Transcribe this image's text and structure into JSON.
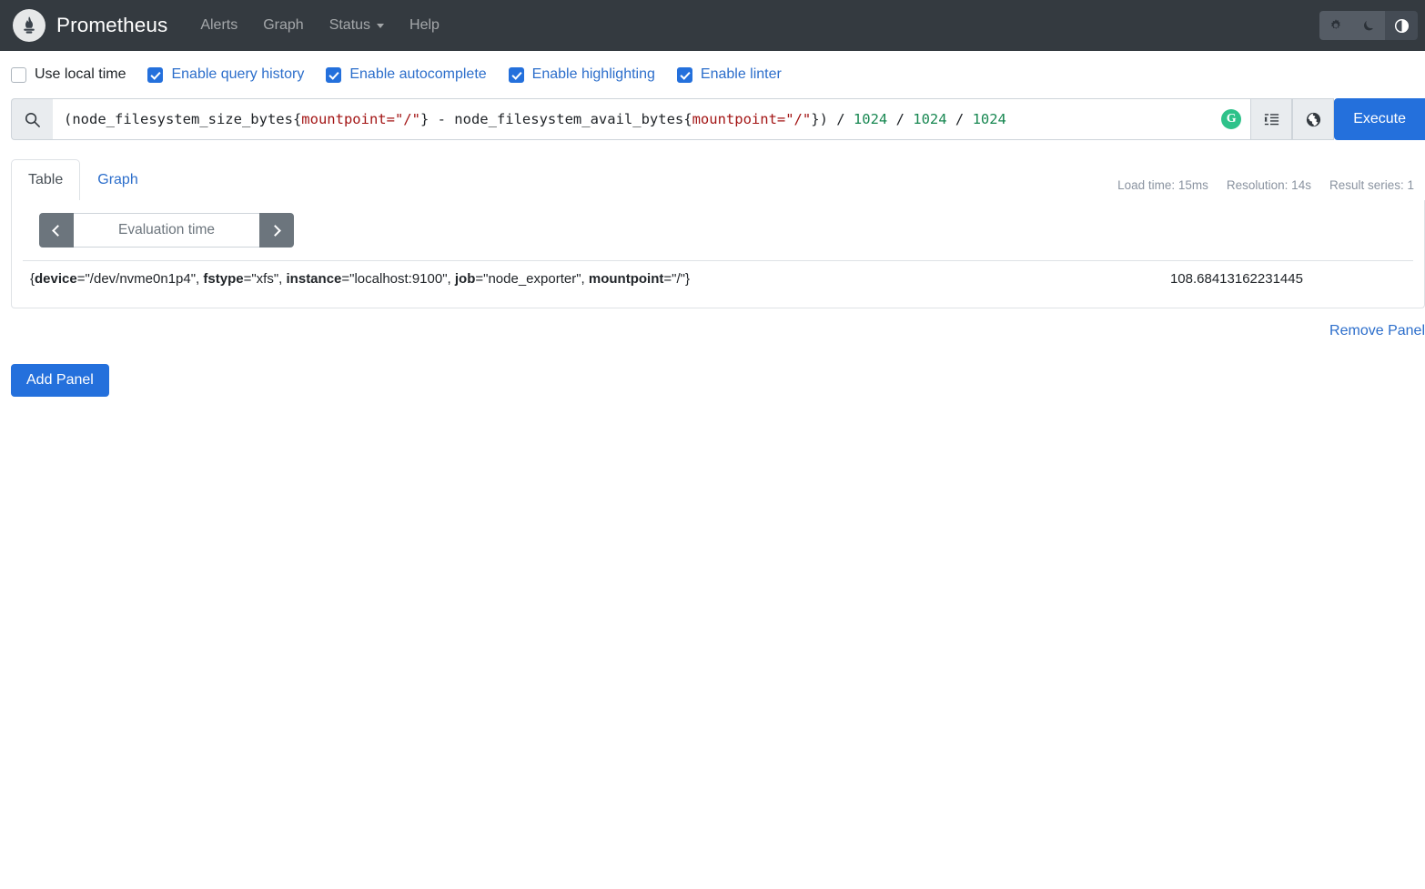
{
  "navbar": {
    "brand": "Prometheus",
    "logo_icon": "prometheus-logo-icon",
    "links": [
      {
        "label": "Alerts",
        "dropdown": false
      },
      {
        "label": "Graph",
        "dropdown": false
      },
      {
        "label": "Status",
        "dropdown": true
      },
      {
        "label": "Help",
        "dropdown": false
      }
    ],
    "theme_buttons": [
      {
        "icon": "gear-icon",
        "name": "light-theme-button",
        "active": false
      },
      {
        "icon": "moon-icon",
        "name": "dark-theme-button",
        "active": false
      },
      {
        "icon": "half-circle-icon",
        "name": "auto-theme-button",
        "active": true
      }
    ]
  },
  "options": [
    {
      "label": "Use local time",
      "checked": false
    },
    {
      "label": "Enable query history",
      "checked": true
    },
    {
      "label": "Enable autocomplete",
      "checked": true
    },
    {
      "label": "Enable highlighting",
      "checked": true
    },
    {
      "label": "Enable linter",
      "checked": true
    }
  ],
  "query": {
    "search_icon": "search-icon",
    "tokens": [
      {
        "text": "(node_filesystem_size_bytes{",
        "type": "plain"
      },
      {
        "text": "mountpoint=\"/\"",
        "type": "label"
      },
      {
        "text": "} - node_filesystem_avail_bytes{",
        "type": "plain"
      },
      {
        "text": "mountpoint=\"/\"",
        "type": "label"
      },
      {
        "text": "}) / ",
        "type": "plain"
      },
      {
        "text": "1024",
        "type": "number"
      },
      {
        "text": " / ",
        "type": "plain"
      },
      {
        "text": "1024",
        "type": "number"
      },
      {
        "text": " / ",
        "type": "plain"
      },
      {
        "text": "1024",
        "type": "number"
      }
    ],
    "plain_text": "(node_filesystem_size_bytes{mountpoint=\"/\"} - node_filesystem_avail_bytes{mountpoint=\"/\"}) / 1024 / 1024 / 1024",
    "grammarly_badge": "G",
    "format_button_icon": "format-indent-icon",
    "explain_button_icon": "globe-icon",
    "execute_label": "Execute"
  },
  "tabs": [
    {
      "label": "Table",
      "active": true
    },
    {
      "label": "Graph",
      "active": false
    }
  ],
  "stats": {
    "load_time": "Load time: 15ms",
    "resolution": "Resolution: 14s",
    "result_series": "Result series: 1"
  },
  "time_control": {
    "prev_icon": "chevron-left-icon",
    "next_icon": "chevron-right-icon",
    "placeholder": "Evaluation time",
    "value": ""
  },
  "results": {
    "rows": [
      {
        "labels": [
          {
            "key": "device",
            "value": "\"/dev/nvme0n1p4\""
          },
          {
            "key": "fstype",
            "value": "\"xfs\""
          },
          {
            "key": "instance",
            "value": "\"localhost:9100\""
          },
          {
            "key": "job",
            "value": "\"node_exporter\""
          },
          {
            "key": "mountpoint",
            "value": "\"/\""
          }
        ],
        "value": "108.68413162231445"
      }
    ]
  },
  "actions": {
    "remove_panel": "Remove Panel",
    "add_panel": "Add Panel"
  },
  "colors": {
    "navbar_bg": "#343a40",
    "accent_blue": "#2470dc",
    "link_blue": "#2c6ecb",
    "label_red": "#a31515",
    "number_green": "#178751",
    "grammarly_green": "#2ec28a",
    "muted_gray": "#6c757d"
  }
}
